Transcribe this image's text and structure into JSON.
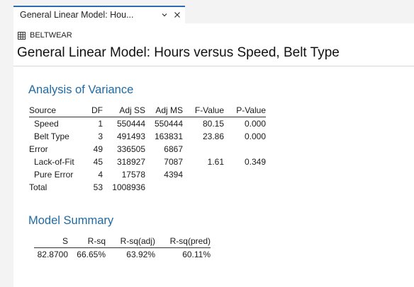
{
  "tab": {
    "title": "General Linear Model: Hou...",
    "chevron_icon": "chevron-down-icon",
    "close_icon": "close-icon"
  },
  "worksheet": {
    "icon": "grid-icon",
    "name": "BELTWEAR"
  },
  "page_title": "General Linear Model: Hours versus Speed, Belt Type",
  "anova": {
    "title": "Analysis of Variance",
    "headers": [
      "Source",
      "DF",
      "Adj SS",
      "Adj MS",
      "F-Value",
      "P-Value"
    ],
    "rows": [
      [
        "Speed",
        "1",
        "550444",
        "550444",
        "80.15",
        "0.000"
      ],
      [
        "Belt Type",
        "3",
        "491493",
        "163831",
        "23.86",
        "0.000"
      ],
      [
        "Error",
        "49",
        "336505",
        "6867",
        "",
        ""
      ],
      [
        "Lack-of-Fit",
        "45",
        "318927",
        "7087",
        "1.61",
        "0.349"
      ],
      [
        "Pure Error",
        "4",
        "17578",
        "4394",
        "",
        ""
      ],
      [
        "Total",
        "53",
        "1008936",
        "",
        "",
        ""
      ]
    ]
  },
  "summary": {
    "title": "Model Summary",
    "headers": [
      "S",
      "R-sq",
      "R-sq(adj)",
      "R-sq(pred)"
    ],
    "rows": [
      [
        "82.8700",
        "66.65%",
        "63.92%",
        "60.11%"
      ]
    ]
  }
}
